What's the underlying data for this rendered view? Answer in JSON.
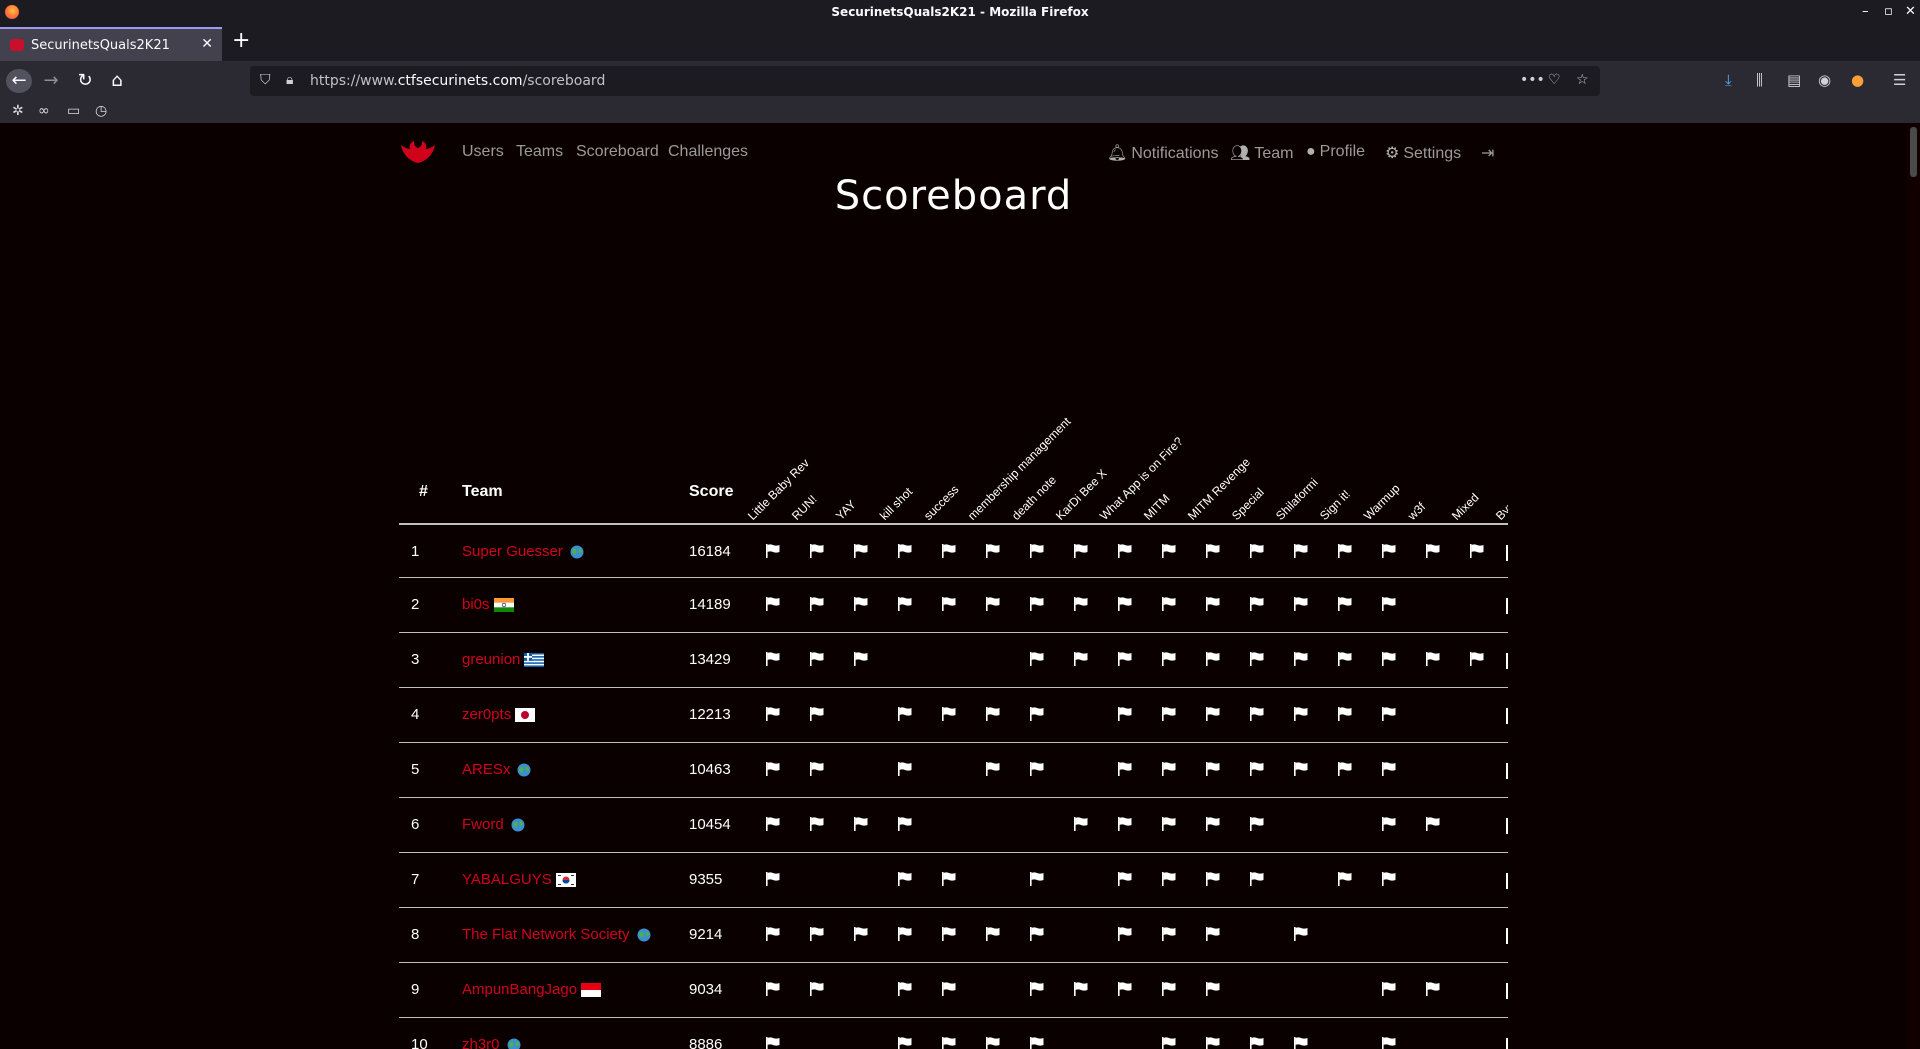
{
  "window": {
    "title": "SecurinetsQuals2K21 - Mozilla Firefox"
  },
  "tab": {
    "title": "SecurinetsQuals2K21"
  },
  "urlbar": {
    "prefix": "https://www.",
    "domain": "ctfsecurinets.com",
    "path": "/scoreboard"
  },
  "nav": {
    "left": [
      "Users",
      "Teams",
      "Scoreboard",
      "Challenges"
    ],
    "right": [
      "Notifications",
      "Team",
      "Profile",
      "Settings"
    ]
  },
  "page": {
    "title": "Scoreboard"
  },
  "table": {
    "headers": {
      "rank": "#",
      "team": "Team",
      "score": "Score"
    },
    "challenges": [
      "Little Baby Rev",
      "RUN!",
      "YAY",
      "kill shot",
      "success",
      "membership management",
      "death note",
      "KarDi Bee X",
      "What App is on Fire?",
      "MITM",
      "MITM Revenge",
      "Special",
      "Shilaformi",
      "Sign it!",
      "Warmup",
      "w3f",
      "Mixed",
      "Byp"
    ],
    "rows": [
      {
        "rank": "1",
        "team": "Super Guesser",
        "country": "world",
        "score": "16184",
        "solved": [
          1,
          1,
          1,
          1,
          1,
          1,
          1,
          1,
          1,
          1,
          1,
          1,
          1,
          1,
          1,
          1,
          1,
          1
        ]
      },
      {
        "rank": "2",
        "team": "bi0s",
        "country": "india",
        "score": "14189",
        "solved": [
          1,
          1,
          1,
          1,
          1,
          1,
          1,
          1,
          1,
          1,
          1,
          1,
          1,
          1,
          1,
          0,
          0,
          1
        ]
      },
      {
        "rank": "3",
        "team": "greunion",
        "country": "greece",
        "score": "13429",
        "solved": [
          1,
          1,
          1,
          0,
          0,
          0,
          1,
          1,
          1,
          1,
          1,
          1,
          1,
          1,
          1,
          1,
          1,
          1
        ]
      },
      {
        "rank": "4",
        "team": "zer0pts",
        "country": "japan",
        "score": "12213",
        "solved": [
          1,
          1,
          0,
          1,
          1,
          1,
          1,
          0,
          1,
          1,
          1,
          1,
          1,
          1,
          1,
          0,
          0,
          1
        ]
      },
      {
        "rank": "5",
        "team": "ARESx",
        "country": "world",
        "score": "10463",
        "solved": [
          1,
          1,
          0,
          1,
          0,
          1,
          1,
          0,
          1,
          1,
          1,
          1,
          1,
          1,
          1,
          0,
          0,
          1
        ]
      },
      {
        "rank": "6",
        "team": "Fword",
        "country": "world",
        "score": "10454",
        "solved": [
          1,
          1,
          1,
          1,
          0,
          0,
          0,
          1,
          1,
          1,
          1,
          1,
          0,
          0,
          1,
          1,
          0,
          1
        ]
      },
      {
        "rank": "7",
        "team": "YABALGUYS",
        "country": "korea",
        "score": "9355",
        "solved": [
          1,
          0,
          0,
          1,
          1,
          0,
          1,
          0,
          1,
          1,
          1,
          1,
          0,
          1,
          1,
          0,
          0,
          1
        ]
      },
      {
        "rank": "8",
        "team": "The Flat Network Society",
        "country": "world",
        "score": "9214",
        "solved": [
          1,
          1,
          1,
          1,
          1,
          1,
          1,
          0,
          1,
          1,
          1,
          0,
          1,
          0,
          0,
          0,
          0,
          1
        ]
      },
      {
        "rank": "9",
        "team": "AmpunBangJago",
        "country": "indonesia",
        "score": "9034",
        "solved": [
          1,
          1,
          0,
          1,
          1,
          0,
          1,
          1,
          1,
          1,
          1,
          0,
          0,
          0,
          1,
          1,
          0,
          1
        ]
      },
      {
        "rank": "10",
        "team": "zh3r0",
        "country": "world",
        "score": "8886",
        "solved": [
          1,
          0,
          0,
          1,
          1,
          1,
          1,
          0,
          0,
          1,
          1,
          1,
          1,
          0,
          1,
          0,
          0,
          1
        ]
      }
    ]
  },
  "colors": {
    "accent": "#d0021b",
    "background": "#0b0000"
  }
}
